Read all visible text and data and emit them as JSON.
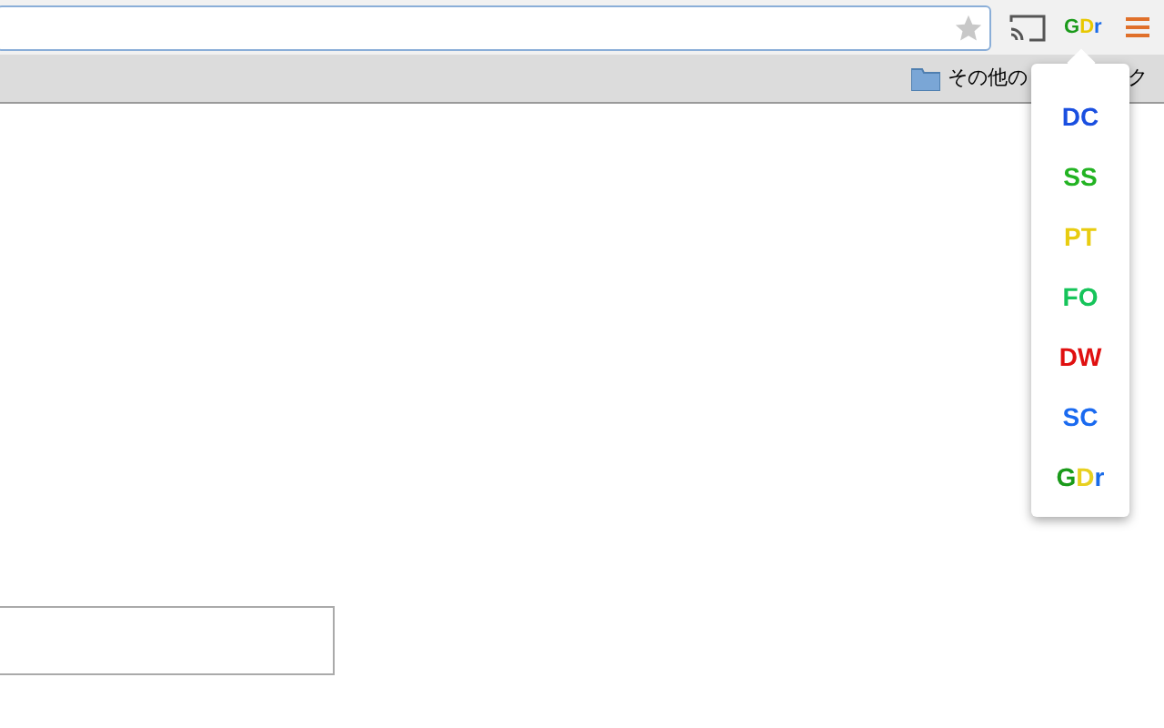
{
  "toolbar": {
    "extension_badge": [
      {
        "text": "G",
        "color": "#1a9a1a"
      },
      {
        "text": "D",
        "color": "#e8c800"
      },
      {
        "text": "r",
        "color": "#1a6be8"
      }
    ]
  },
  "bookmarks_bar": {
    "folder_label": "その他の",
    "folder_label_tail": "ク"
  },
  "popup_menu": [
    {
      "kind": "text",
      "label": "DC",
      "color": "#1a4fe0"
    },
    {
      "kind": "text",
      "label": "SS",
      "color": "#22b322"
    },
    {
      "kind": "text",
      "label": "PT",
      "color": "#e8cc10"
    },
    {
      "kind": "text",
      "label": "FO",
      "color": "#16c45a"
    },
    {
      "kind": "text",
      "label": "DW",
      "color": "#e01010"
    },
    {
      "kind": "text",
      "label": "SC",
      "color": "#1a6af0"
    },
    {
      "kind": "logo",
      "letters": [
        {
          "text": "G",
          "color": "#1a9a1a"
        },
        {
          "text": "D",
          "color": "#e8d020"
        },
        {
          "text": "r",
          "color": "#1a6be8"
        }
      ]
    }
  ]
}
